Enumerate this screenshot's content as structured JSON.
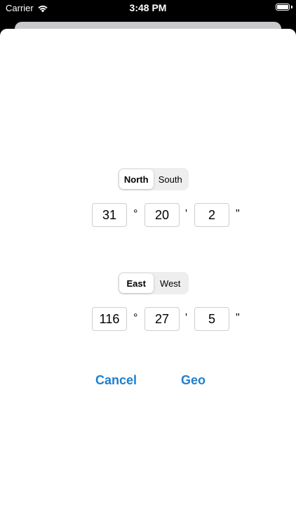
{
  "status_bar": {
    "carrier": "Carrier",
    "time": "3:48 PM",
    "battery_level": 1.0
  },
  "latitude": {
    "segments": [
      "North",
      "South"
    ],
    "selected": "North",
    "degrees": "31",
    "minutes": "20",
    "seconds": "2"
  },
  "longitude": {
    "segments": [
      "East",
      "West"
    ],
    "selected": "East",
    "degrees": "116",
    "minutes": "27",
    "seconds": "5"
  },
  "units": {
    "degree": "°",
    "minute": "'",
    "second": "\""
  },
  "actions": {
    "cancel": "Cancel",
    "geo": "Geo"
  },
  "colors": {
    "accent": "#1d7fcf",
    "segment_bg": "#eeeeef",
    "field_border": "#cfcfd2"
  }
}
